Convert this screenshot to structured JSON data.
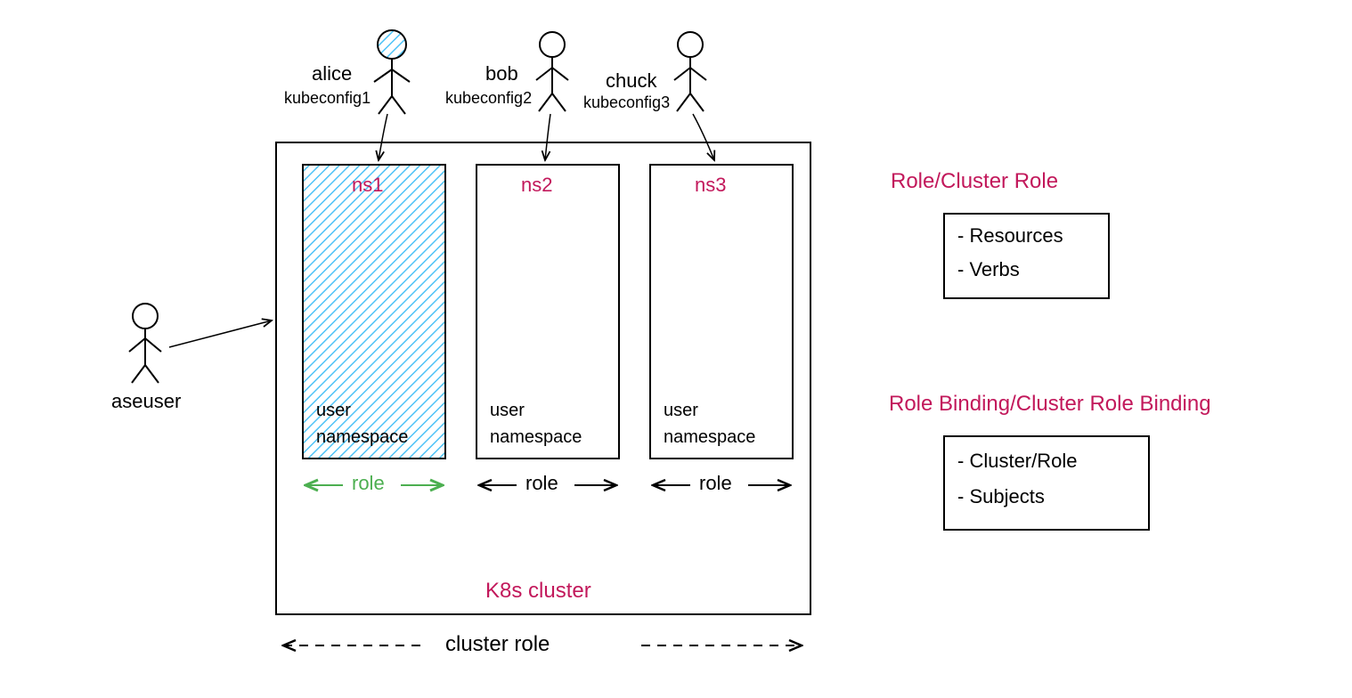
{
  "users": {
    "aseuser": {
      "name": "aseuser"
    },
    "alice": {
      "name": "alice",
      "config": "kubeconfig1"
    },
    "bob": {
      "name": "bob",
      "config": "kubeconfig2"
    },
    "chuck": {
      "name": "chuck",
      "config": "kubeconfig3"
    }
  },
  "cluster": {
    "label": "K8s cluster",
    "namespaces": [
      {
        "id": "ns1",
        "userLabel": "user",
        "nsLabel": "namespace",
        "roleLabel": "role"
      },
      {
        "id": "ns2",
        "userLabel": "user",
        "nsLabel": "namespace",
        "roleLabel": "role"
      },
      {
        "id": "ns3",
        "userLabel": "user",
        "nsLabel": "namespace",
        "roleLabel": "role"
      }
    ],
    "clusterRoleLabel": "cluster role"
  },
  "legend": {
    "roleTitle": "Role/Cluster Role",
    "roleItems": [
      "Resources",
      "Verbs"
    ],
    "bindingTitle": "Role Binding/Cluster Role Binding",
    "bindingItems": [
      "Cluster/Role",
      "Subjects"
    ]
  }
}
